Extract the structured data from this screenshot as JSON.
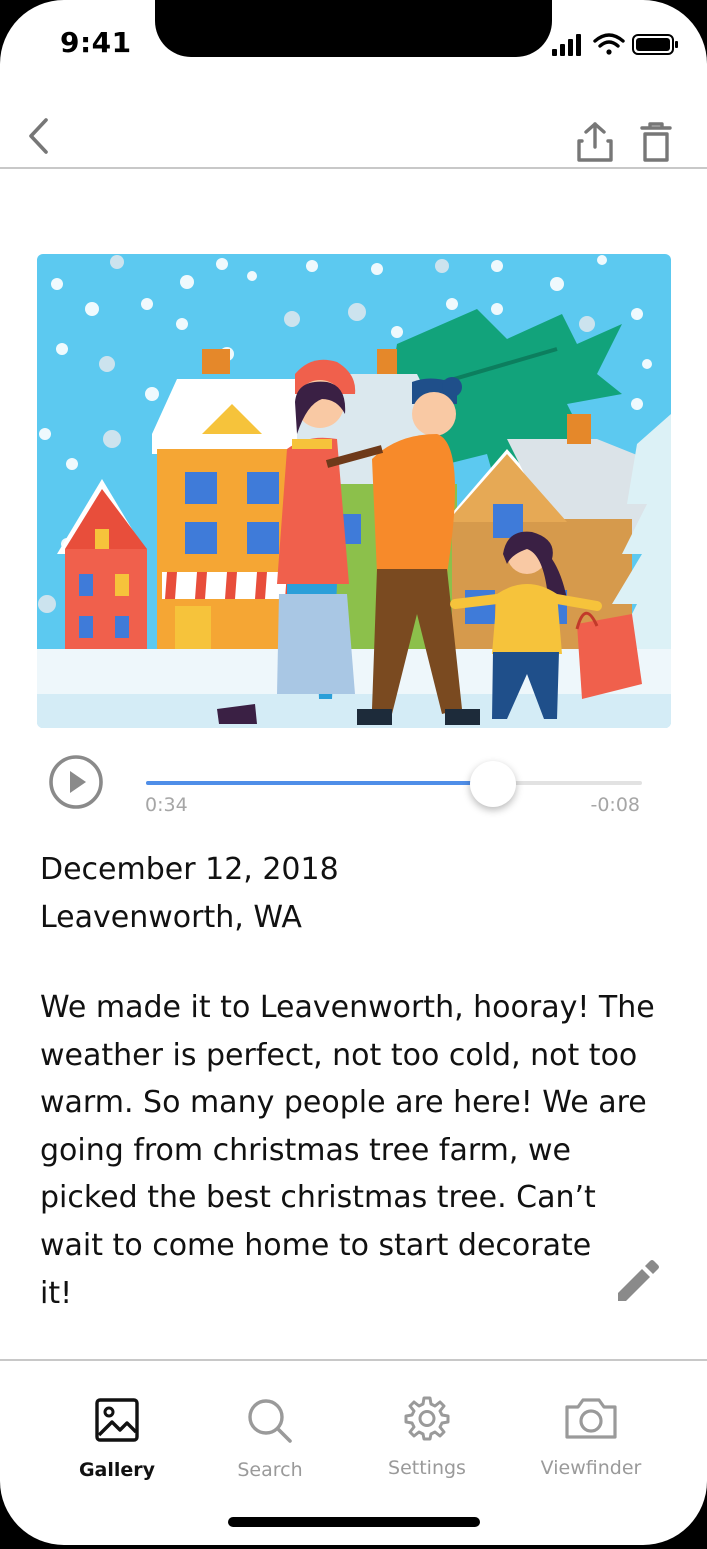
{
  "status_bar": {
    "time": "9:41"
  },
  "nav": {
    "back_icon": "chevron-left-icon",
    "share_icon": "share-icon",
    "delete_icon": "trash-icon"
  },
  "player": {
    "elapsed": "0:34",
    "remaining": "-0:08",
    "progress": 0.7
  },
  "entry": {
    "date": "December 12, 2018",
    "location": "Leavenworth, WA",
    "lines": [
      "We made it to Leavenworth, hooray! The",
      "weather is perfect, not too cold, not too",
      "warm. So many people are here! We are",
      "going from christmas tree farm, we",
      "picked the best christmas tree. Can’t",
      "wait to come home to start decorate",
      "it!"
    ]
  },
  "tabs": [
    {
      "label": "Gallery",
      "icon": "image-icon",
      "active": true
    },
    {
      "label": "Search",
      "icon": "search-icon",
      "active": false
    },
    {
      "label": "Settings",
      "icon": "gear-icon",
      "active": false
    },
    {
      "label": "Viewfinder",
      "icon": "camera-icon",
      "active": false
    }
  ],
  "colors": {
    "accent": "#4f8ee8",
    "inactive": "#9a9a9a",
    "active": "#111111"
  }
}
